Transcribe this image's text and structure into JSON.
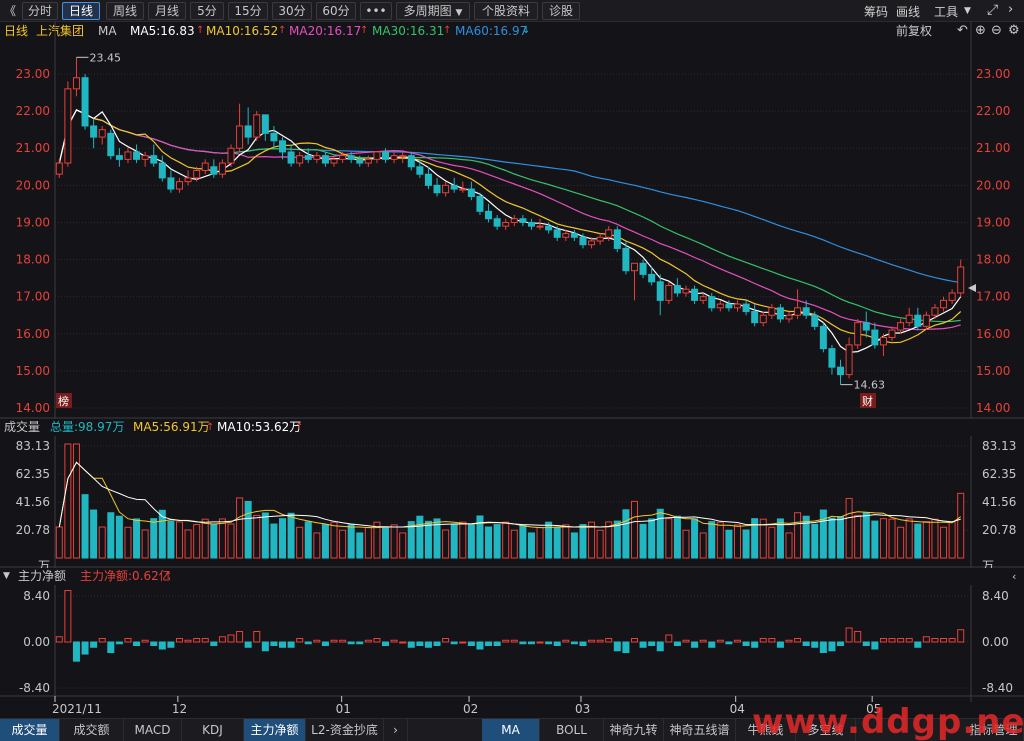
{
  "toolbar": {
    "back": "《",
    "tabs": [
      "分时",
      "日线",
      "周线",
      "月线",
      "5分",
      "15分",
      "30分",
      "60分",
      "•••",
      "多周期图",
      "个股资料",
      "诊股"
    ],
    "active_tab": "日线",
    "right": [
      "筹码",
      "画线",
      "工具"
    ]
  },
  "ma_header": {
    "period": "日线",
    "stock": "上汽集团",
    "ma_label": "MA",
    "ma5": "MA5:16.83",
    "ma10": "MA10:16.52",
    "ma20": "MA20:16.17",
    "ma30": "MA30:16.31",
    "ma60": "MA60:16.97",
    "adjust": "前复权"
  },
  "colors": {
    "up": "#e8403a",
    "down": "#20b7c2",
    "ma5": "#ffffff",
    "ma10": "#f3c62a",
    "ma20": "#e64fbf",
    "ma30": "#34c26a",
    "ma60": "#2f8fe0",
    "grid": "#2a2a30",
    "axis_text": "#e8403a"
  },
  "price_axis": [
    "23.00",
    "22.00",
    "21.00",
    "20.00",
    "19.00",
    "18.00",
    "17.00",
    "16.00",
    "15.00",
    "14.00"
  ],
  "price_annotations": {
    "high": "23.45",
    "low": "14.63",
    "badge_left": "榜",
    "badge_right": "财"
  },
  "volume": {
    "label": "成交量",
    "total": "总量:98.97万",
    "ma5": "MA5:56.91万",
    "ma10": "MA10:53.62万",
    "axis": [
      "83.13",
      "62.35",
      "41.56",
      "20.78",
      "万"
    ]
  },
  "flow": {
    "label": "主力净额",
    "value": "主力净额:0.62亿",
    "axis": [
      "8.40",
      "0.00",
      "-8.40"
    ]
  },
  "dates": [
    "2021/11",
    "12",
    "01",
    "02",
    "03",
    "04",
    "05"
  ],
  "bottom_left_tabs": [
    "成交量",
    "成交额",
    "MACD",
    "KDJ",
    "主力净额",
    "L2-资金抄底"
  ],
  "bottom_right_tabs": [
    "MA",
    "BOLL",
    "神奇九转",
    "神奇五线谱",
    "牛熊线",
    "多空线",
    "指标管理"
  ],
  "watermark": "www.ddgp.net",
  "chart_data": {
    "type": "candlestick",
    "title": "上汽集团 日线",
    "ylim": [
      14.0,
      23.5
    ],
    "series_ma": [
      "MA5",
      "MA10",
      "MA20",
      "MA30",
      "MA60"
    ],
    "candles": [
      [
        20.3,
        20.7,
        20.6,
        20.2
      ],
      [
        20.6,
        22.8,
        22.6,
        20.5
      ],
      [
        22.6,
        23.45,
        22.9,
        22.4
      ],
      [
        22.9,
        23.0,
        21.6,
        21.5
      ],
      [
        21.6,
        21.8,
        21.3,
        21.0
      ],
      [
        21.3,
        21.6,
        21.5,
        21.1
      ],
      [
        21.4,
        21.5,
        20.8,
        20.7
      ],
      [
        20.8,
        21.0,
        20.7,
        20.5
      ],
      [
        20.7,
        21.0,
        20.9,
        20.6
      ],
      [
        20.9,
        21.1,
        20.7,
        20.6
      ],
      [
        20.7,
        20.9,
        20.8,
        20.5
      ],
      [
        20.8,
        21.1,
        20.6,
        20.5
      ],
      [
        20.6,
        20.8,
        20.2,
        20.1
      ],
      [
        20.2,
        20.4,
        19.9,
        19.8
      ],
      [
        19.9,
        20.2,
        20.1,
        19.8
      ],
      [
        20.1,
        20.4,
        20.2,
        20.0
      ],
      [
        20.2,
        20.5,
        20.4,
        20.1
      ],
      [
        20.4,
        20.7,
        20.6,
        20.3
      ],
      [
        20.5,
        20.7,
        20.3,
        20.2
      ],
      [
        20.3,
        20.7,
        20.6,
        20.2
      ],
      [
        20.6,
        21.1,
        21.0,
        20.5
      ],
      [
        21.0,
        22.2,
        21.6,
        20.9
      ],
      [
        21.6,
        22.1,
        21.3,
        21.1
      ],
      [
        21.3,
        22.0,
        21.9,
        21.2
      ],
      [
        21.9,
        21.9,
        21.4,
        21.2
      ],
      [
        21.4,
        21.6,
        21.2,
        21.0
      ],
      [
        21.2,
        21.3,
        20.9,
        20.7
      ],
      [
        20.9,
        21.1,
        20.6,
        20.5
      ],
      [
        20.6,
        20.9,
        20.8,
        20.5
      ],
      [
        20.8,
        21.0,
        20.7,
        20.6
      ],
      [
        20.7,
        20.9,
        20.8,
        20.6
      ],
      [
        20.8,
        20.9,
        20.6,
        20.5
      ],
      [
        20.6,
        20.8,
        20.7,
        20.5
      ],
      [
        20.7,
        20.9,
        20.8,
        20.6
      ],
      [
        20.8,
        20.9,
        20.7,
        20.6
      ],
      [
        20.7,
        20.8,
        20.6,
        20.5
      ],
      [
        20.6,
        20.8,
        20.7,
        20.5
      ],
      [
        20.7,
        20.9,
        20.9,
        20.6
      ],
      [
        20.9,
        21.0,
        20.7,
        20.6
      ],
      [
        20.7,
        20.9,
        20.8,
        20.6
      ],
      [
        20.8,
        20.9,
        20.8,
        20.6
      ],
      [
        20.8,
        20.9,
        20.5,
        20.4
      ],
      [
        20.5,
        20.7,
        20.3,
        20.2
      ],
      [
        20.3,
        20.5,
        20.0,
        19.9
      ],
      [
        20.0,
        20.2,
        19.8,
        19.7
      ],
      [
        19.8,
        20.1,
        20.0,
        19.7
      ],
      [
        20.0,
        20.2,
        19.9,
        19.8
      ],
      [
        19.9,
        20.1,
        19.9,
        19.8
      ],
      [
        19.9,
        20.1,
        19.7,
        19.6
      ],
      [
        19.7,
        19.8,
        19.3,
        19.2
      ],
      [
        19.3,
        19.5,
        19.1,
        19.0
      ],
      [
        19.1,
        19.2,
        18.9,
        18.8
      ],
      [
        18.9,
        19.1,
        19.0,
        18.8
      ],
      [
        19.0,
        19.2,
        19.1,
        18.9
      ],
      [
        19.1,
        19.2,
        19.0,
        18.9
      ],
      [
        19.0,
        19.1,
        18.9,
        18.8
      ],
      [
        18.9,
        19.1,
        18.9,
        18.8
      ],
      [
        18.9,
        19.0,
        18.8,
        18.7
      ],
      [
        18.8,
        18.9,
        18.6,
        18.5
      ],
      [
        18.6,
        18.8,
        18.7,
        18.5
      ],
      [
        18.7,
        18.8,
        18.6,
        18.5
      ],
      [
        18.6,
        18.7,
        18.4,
        18.3
      ],
      [
        18.4,
        18.6,
        18.5,
        18.3
      ],
      [
        18.5,
        18.7,
        18.6,
        18.4
      ],
      [
        18.6,
        18.9,
        18.8,
        18.5
      ],
      [
        18.8,
        18.9,
        18.3,
        18.2
      ],
      [
        18.3,
        18.5,
        17.7,
        17.6
      ],
      [
        17.7,
        17.9,
        17.9,
        16.9
      ],
      [
        17.9,
        18.0,
        17.6,
        17.5
      ],
      [
        17.6,
        17.8,
        17.4,
        17.3
      ],
      [
        17.4,
        17.6,
        16.9,
        16.5
      ],
      [
        16.9,
        17.4,
        17.3,
        16.8
      ],
      [
        17.3,
        17.5,
        17.1,
        17.0
      ],
      [
        17.1,
        17.3,
        17.2,
        17.0
      ],
      [
        17.2,
        17.3,
        16.9,
        16.8
      ],
      [
        16.9,
        17.1,
        17.0,
        16.8
      ],
      [
        17.0,
        17.1,
        16.7,
        16.6
      ],
      [
        16.7,
        16.9,
        16.8,
        16.6
      ],
      [
        16.8,
        16.9,
        16.7,
        16.6
      ],
      [
        16.7,
        16.9,
        16.8,
        16.6
      ],
      [
        16.8,
        16.9,
        16.6,
        16.5
      ],
      [
        16.6,
        16.8,
        16.3,
        16.2
      ],
      [
        16.3,
        16.6,
        16.5,
        16.2
      ],
      [
        16.5,
        16.8,
        16.7,
        16.4
      ],
      [
        16.7,
        16.8,
        16.4,
        16.3
      ],
      [
        16.4,
        16.6,
        16.5,
        16.3
      ],
      [
        16.5,
        17.2,
        16.7,
        16.4
      ],
      [
        16.7,
        16.9,
        16.5,
        16.4
      ],
      [
        16.5,
        16.6,
        16.2,
        16.1
      ],
      [
        16.2,
        16.3,
        15.6,
        15.5
      ],
      [
        15.6,
        15.7,
        15.1,
        14.9
      ],
      [
        15.1,
        15.3,
        14.9,
        14.63
      ],
      [
        14.9,
        15.9,
        15.7,
        14.8
      ],
      [
        15.7,
        16.4,
        16.3,
        15.6
      ],
      [
        16.3,
        16.6,
        16.1,
        15.9
      ],
      [
        16.1,
        16.3,
        15.7,
        15.6
      ],
      [
        15.7,
        16.0,
        15.9,
        15.4
      ],
      [
        15.9,
        16.2,
        16.1,
        15.8
      ],
      [
        16.1,
        16.4,
        16.3,
        16.0
      ],
      [
        16.3,
        16.7,
        16.5,
        16.2
      ],
      [
        16.5,
        16.7,
        16.2,
        16.1
      ],
      [
        16.2,
        16.6,
        16.5,
        16.1
      ],
      [
        16.5,
        16.8,
        16.7,
        16.4
      ],
      [
        16.7,
        17.0,
        16.9,
        16.6
      ],
      [
        16.9,
        17.2,
        17.1,
        16.8
      ],
      [
        17.1,
        18.0,
        17.8,
        17.0
      ]
    ]
  }
}
